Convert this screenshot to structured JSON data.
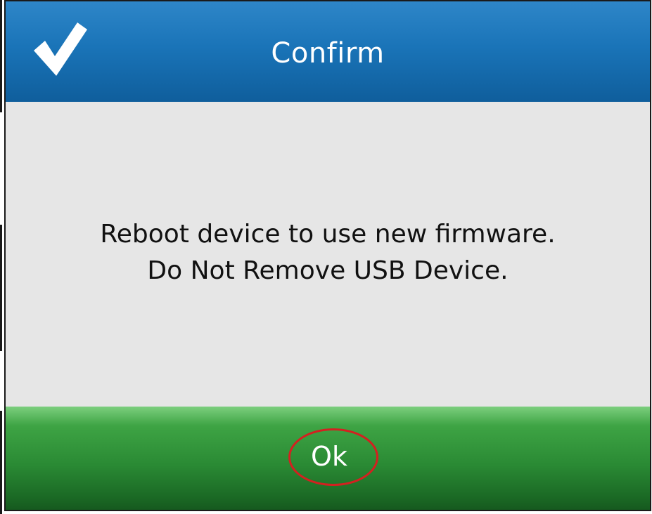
{
  "dialog": {
    "title": "Confirm",
    "header_icon": "checkmark-icon",
    "message_lines": [
      "Reboot device to use new firmware.",
      "Do Not Remove USB Device."
    ],
    "ok_button_label": "Ok"
  },
  "colors": {
    "header": "#1a74b8",
    "body": "#e6e6e6",
    "footer": "#2a8a34",
    "highlight": "#d42020",
    "text_light": "#ffffff",
    "text_dark": "#111111"
  }
}
